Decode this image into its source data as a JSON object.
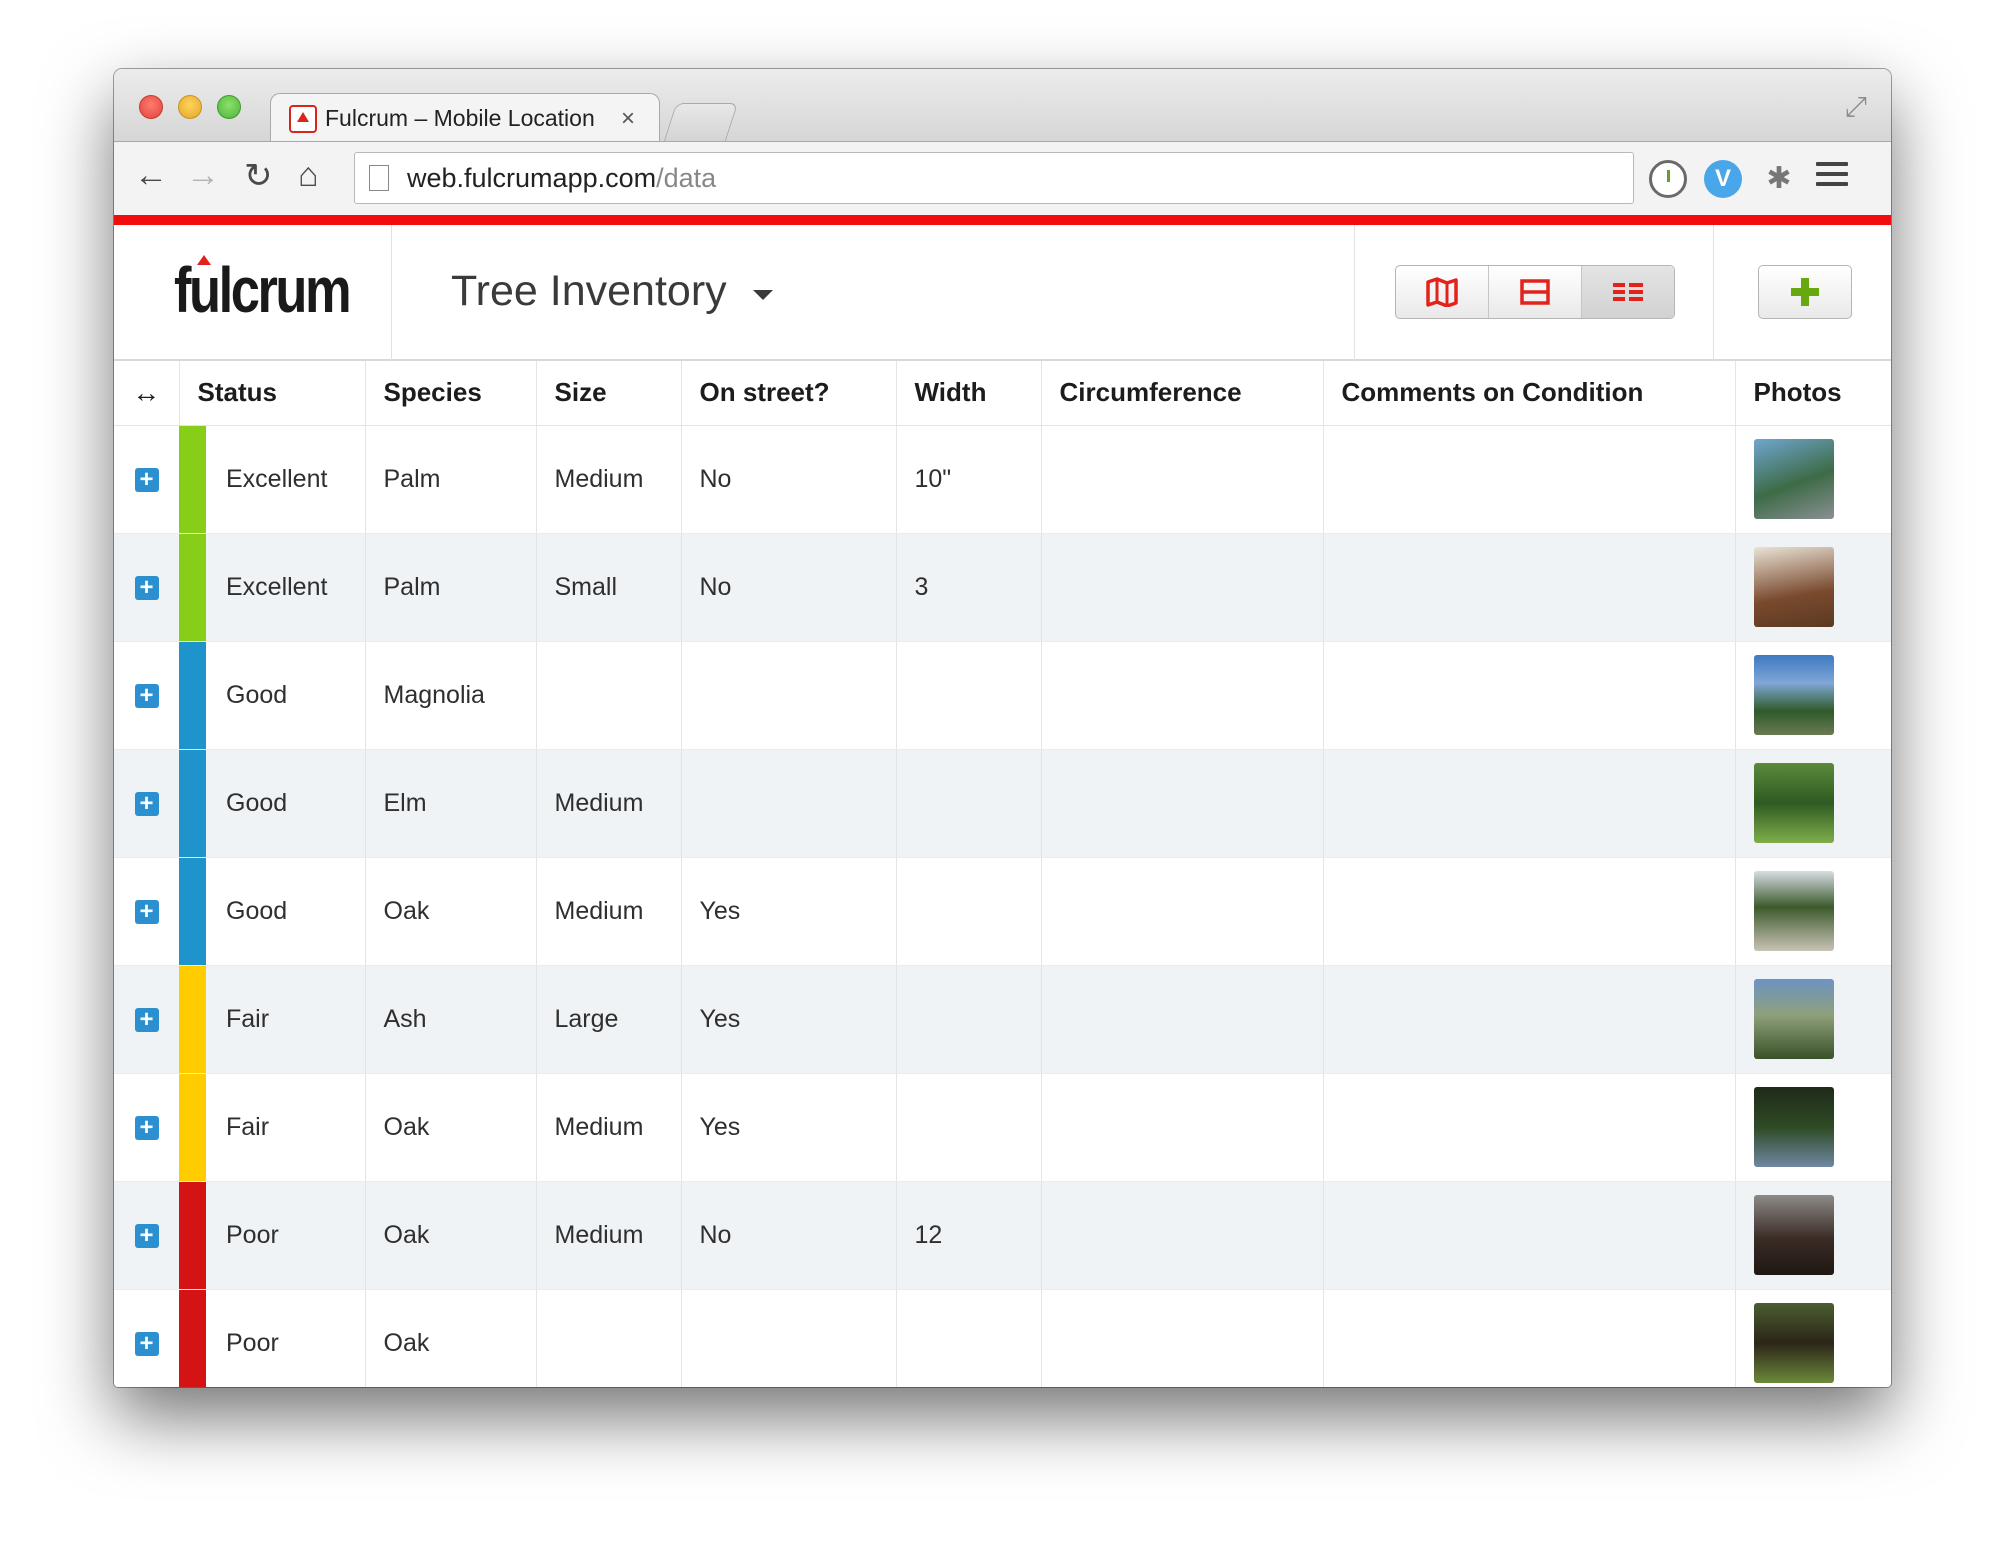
{
  "browser": {
    "tab_title": "Fulcrum – Mobile Location",
    "tab_close": "×",
    "url_domain": "web.fulcrumapp.com",
    "url_path": "/data"
  },
  "app": {
    "logo": "fulcrum",
    "project_title": "Tree Inventory",
    "accent_color": "#f10d0d",
    "views": [
      {
        "icon": "map-icon"
      },
      {
        "icon": "split-view-icon"
      },
      {
        "icon": "table-view-icon",
        "active": true
      }
    ],
    "add_icon": "plus-icon"
  },
  "table": {
    "columns": [
      "Status",
      "Species",
      "Size",
      "On street?",
      "Width",
      "Circumference",
      "Comments on Condition",
      "Photos"
    ],
    "expand_header": "↔",
    "status_colors": {
      "Excellent": "#87ce19",
      "Good": "#1f93cc",
      "Fair": "#ffcc00",
      "Poor": "#d41414"
    },
    "rows": [
      {
        "status": "Excellent",
        "species": "Palm",
        "size": "Medium",
        "on_street": "No",
        "width": "10\"",
        "circumference": "",
        "comments": ""
      },
      {
        "status": "Excellent",
        "species": "Palm",
        "size": "Small",
        "on_street": "No",
        "width": "3",
        "circumference": "",
        "comments": ""
      },
      {
        "status": "Good",
        "species": "Magnolia",
        "size": "",
        "on_street": "",
        "width": "",
        "circumference": "",
        "comments": ""
      },
      {
        "status": "Good",
        "species": "Elm",
        "size": "Medium",
        "on_street": "",
        "width": "",
        "circumference": "",
        "comments": ""
      },
      {
        "status": "Good",
        "species": "Oak",
        "size": "Medium",
        "on_street": "Yes",
        "width": "",
        "circumference": "",
        "comments": ""
      },
      {
        "status": "Fair",
        "species": "Ash",
        "size": "Large",
        "on_street": "Yes",
        "width": "",
        "circumference": "",
        "comments": ""
      },
      {
        "status": "Fair",
        "species": "Oak",
        "size": "Medium",
        "on_street": "Yes",
        "width": "",
        "circumference": "",
        "comments": ""
      },
      {
        "status": "Poor",
        "species": "Oak",
        "size": "Medium",
        "on_street": "No",
        "width": "12",
        "circumference": "",
        "comments": ""
      },
      {
        "status": "Poor",
        "species": "Oak",
        "size": "",
        "on_street": "",
        "width": "",
        "circumference": "",
        "comments": ""
      }
    ]
  }
}
